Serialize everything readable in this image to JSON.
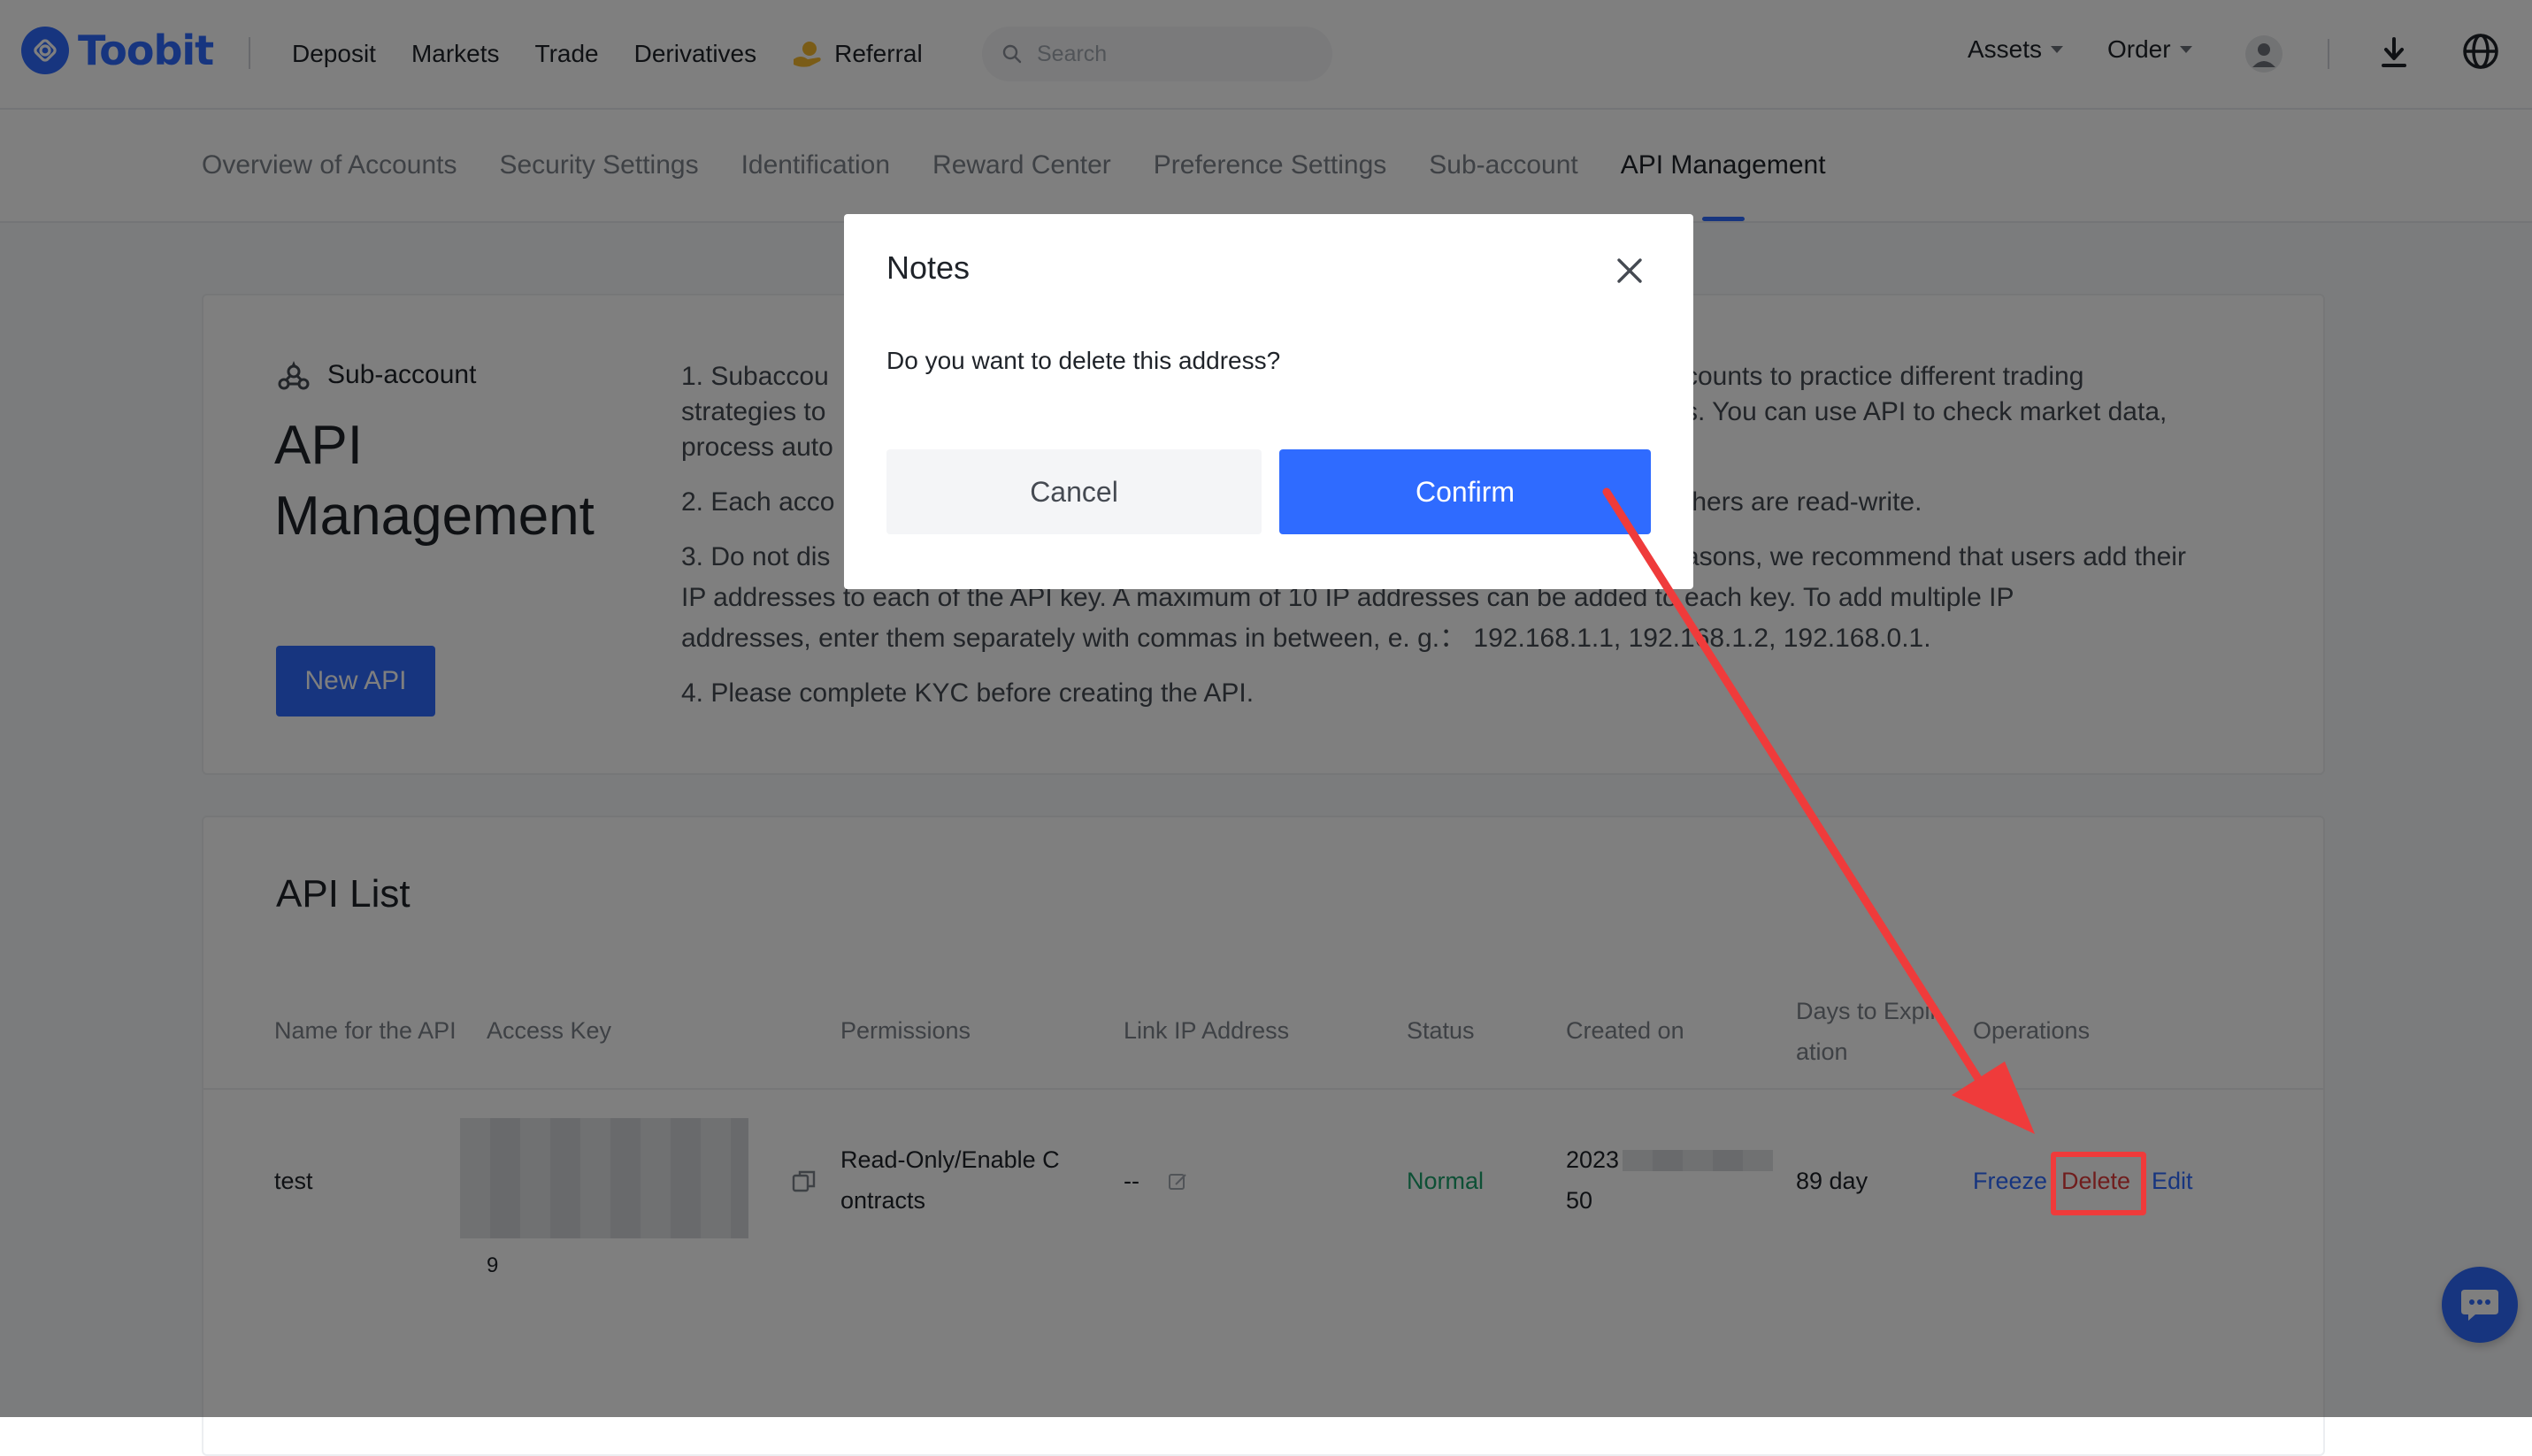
{
  "brand": {
    "name": "Toobit",
    "color": "#2f6bff"
  },
  "topnav": {
    "links": [
      "Deposit",
      "Markets",
      "Trade",
      "Derivatives",
      "Referral"
    ],
    "search_placeholder": "Search",
    "assets_label": "Assets",
    "order_label": "Order",
    "icons": [
      "search-icon",
      "user-avatar-icon",
      "download-icon",
      "globe-icon",
      "referral-gift-icon"
    ]
  },
  "subnav": {
    "tabs": [
      "Overview of Accounts",
      "Security Settings",
      "Identification",
      "Reward Center",
      "Preference Settings",
      "Sub-account",
      "API Management"
    ],
    "active_index": 6
  },
  "intro": {
    "sub_label": "Sub-account",
    "title": "API Management",
    "new_api_button": "New API",
    "notes": [
      "1. Subaccou",
      "counts to practice different trading",
      "strategies to",
      "s. You can use API to check market data,",
      "process auto",
      "2. Each acco",
      "thers are read-write.",
      "3. Do not dis",
      "asons, we recommend that users add their",
      "IP addresses to each of the API key. A maximum of 10 IP addresses can be added to each key. To add multiple IP",
      "addresses, enter them separately with commas in between, e. g.：  192.168.1.1,  192.168.1.2, 192.168.0.1.",
      "4. Please complete KYC before creating the API."
    ]
  },
  "api_list": {
    "title": "API List",
    "columns": [
      "Name for the API",
      "Access Key",
      "Permissions",
      "Link IP Address",
      "Status",
      "Created on",
      "Days to Expir",
      "ation",
      "Operations"
    ],
    "rows": [
      {
        "name": "test",
        "access_key_tail": "9",
        "permissions_line1": "Read-Only/Enable C",
        "permissions_line2": "ontracts",
        "link_ip": "--",
        "status": "Normal",
        "created_line1": "2023",
        "created_line2": "50",
        "days_to_expiration": "89 day",
        "operations": [
          "Freeze",
          "Delete",
          "Edit"
        ]
      }
    ]
  },
  "modal": {
    "title": "Notes",
    "message": "Do you want to delete this address?",
    "cancel_label": "Cancel",
    "confirm_label": "Confirm"
  },
  "colors": {
    "primary": "#2f6bff",
    "status_normal": "#1aa06a",
    "delete_red": "#e03a3a",
    "annotation_red": "#ef3b3b"
  }
}
